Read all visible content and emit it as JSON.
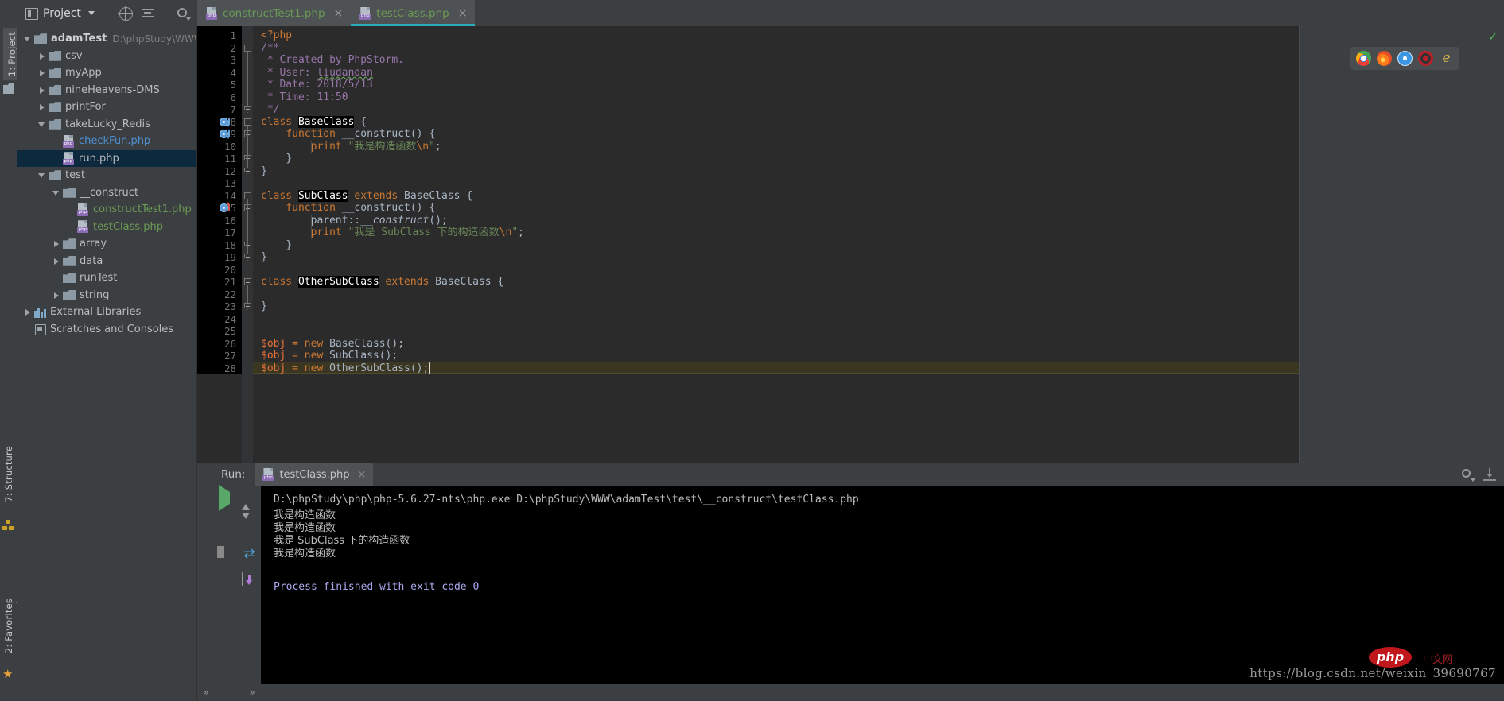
{
  "window": {
    "ide": "PhpStorm"
  },
  "toolbar": {
    "project_button": "Project",
    "icons": [
      "locate-target-icon",
      "collapse-all-icon",
      "settings-gear-icon",
      "hide-panel-icon"
    ]
  },
  "editor_tabs": [
    {
      "label": "constructTest1.php",
      "close": "×",
      "active": false,
      "icon": "php-file-icon"
    },
    {
      "label": "testClass.php",
      "close": "×",
      "active": true,
      "icon": "php-file-icon"
    }
  ],
  "left_tool_window_tabs": [
    {
      "label": "1: Project",
      "selected": true
    },
    {
      "label": "7: Structure",
      "selected": false
    },
    {
      "label": "2: Favorites",
      "selected": false
    }
  ],
  "project_tree": [
    {
      "depth": 0,
      "arrow": "down",
      "icon": "folder",
      "label": "adamTest",
      "bold": true,
      "path": "D:\\phpStudy\\WWW",
      "selected": false
    },
    {
      "depth": 1,
      "arrow": "right",
      "icon": "folder",
      "label": "csv",
      "selected": false
    },
    {
      "depth": 1,
      "arrow": "right",
      "icon": "folder",
      "label": "myApp",
      "selected": false
    },
    {
      "depth": 1,
      "arrow": "right",
      "icon": "folder",
      "label": "nineHeavens-DMS",
      "selected": false
    },
    {
      "depth": 1,
      "arrow": "right",
      "icon": "folder",
      "label": "printFor",
      "selected": false
    },
    {
      "depth": 1,
      "arrow": "down",
      "icon": "folder",
      "label": "takeLucky_Redis",
      "selected": false
    },
    {
      "depth": 2,
      "arrow": "none",
      "icon": "php",
      "label": "checkFun.php",
      "kind": "php-blue",
      "selected": false
    },
    {
      "depth": 2,
      "arrow": "none",
      "icon": "php",
      "label": "run.php",
      "kind": "plain",
      "selected": true
    },
    {
      "depth": 1,
      "arrow": "down",
      "icon": "folder",
      "label": "test",
      "selected": false
    },
    {
      "depth": 2,
      "arrow": "down",
      "icon": "folder",
      "label": "__construct",
      "selected": false
    },
    {
      "depth": 3,
      "arrow": "none",
      "icon": "php",
      "label": "constructTest1.php",
      "kind": "php",
      "selected": false
    },
    {
      "depth": 3,
      "arrow": "none",
      "icon": "php",
      "label": "testClass.php",
      "kind": "php",
      "selected": false
    },
    {
      "depth": 2,
      "arrow": "right",
      "icon": "folder",
      "label": "array",
      "selected": false
    },
    {
      "depth": 2,
      "arrow": "right",
      "icon": "folder",
      "label": "data",
      "selected": false
    },
    {
      "depth": 2,
      "arrow": "none",
      "icon": "folder",
      "label": "runTest",
      "selected": false
    },
    {
      "depth": 2,
      "arrow": "right",
      "icon": "folder",
      "label": "string",
      "selected": false
    },
    {
      "depth": 0,
      "arrow": "right",
      "icon": "library",
      "label": "External Libraries",
      "selected": false
    },
    {
      "depth": 0,
      "arrow": "none",
      "icon": "scratch",
      "label": "Scratches and Consoles",
      "selected": false
    }
  ],
  "code": {
    "file": "testClass.php",
    "first_line": 1,
    "last_line": 28,
    "caret_line": 28,
    "highlighted_line": 28,
    "lines": [
      {
        "n": 1,
        "text": "<?php"
      },
      {
        "n": 2,
        "text": "/**"
      },
      {
        "n": 3,
        "text": " * Created by PhpStorm."
      },
      {
        "n": 4,
        "text": " * User: liudandan"
      },
      {
        "n": 5,
        "text": " * Date: 2018/5/13"
      },
      {
        "n": 6,
        "text": " * Time: 11:50"
      },
      {
        "n": 7,
        "text": " */"
      },
      {
        "n": 8,
        "text": "class BaseClass {"
      },
      {
        "n": 9,
        "text": "    function __construct() {"
      },
      {
        "n": 10,
        "text": "        print \"我是构造函数\\n\";"
      },
      {
        "n": 11,
        "text": "    }"
      },
      {
        "n": 12,
        "text": "}"
      },
      {
        "n": 13,
        "text": ""
      },
      {
        "n": 14,
        "text": "class SubClass extends BaseClass {"
      },
      {
        "n": 15,
        "text": "    function __construct() {"
      },
      {
        "n": 16,
        "text": "        parent::__construct();"
      },
      {
        "n": 17,
        "text": "        print \"我是 SubClass 下的构造函数\\n\";"
      },
      {
        "n": 18,
        "text": "    }"
      },
      {
        "n": 19,
        "text": "}"
      },
      {
        "n": 20,
        "text": ""
      },
      {
        "n": 21,
        "text": "class OtherSubClass extends BaseClass {"
      },
      {
        "n": 22,
        "text": ""
      },
      {
        "n": 23,
        "text": "}"
      },
      {
        "n": 24,
        "text": ""
      },
      {
        "n": 25,
        "text": ""
      },
      {
        "n": 26,
        "text": "$obj = new BaseClass();"
      },
      {
        "n": 27,
        "text": "$obj = new SubClass();"
      },
      {
        "n": 28,
        "text": "$obj = new OtherSubClass();"
      }
    ]
  },
  "browser_bar": {
    "icons": [
      "chrome-icon",
      "firefox-icon",
      "safari-icon",
      "opera-icon",
      "edge-icon"
    ]
  },
  "inspection": {
    "status": "ok-checkmark"
  },
  "run_panel": {
    "label": "Run:",
    "tab": {
      "label": "testClass.php",
      "close": "×",
      "icon": "php-run-icon"
    },
    "header_icons": [
      "settings-gear-icon",
      "export-icon"
    ],
    "tool_icons": [
      "rerun-play-icon",
      "stop-icon",
      "pause-icon",
      "scroll-up-icon",
      "scroll-down-icon",
      "soft-wrap-icon",
      "print-icon"
    ],
    "console": [
      {
        "text": "D:\\phpStudy\\php\\php-5.6.27-nts\\php.exe D:\\phpStudy\\WWW\\adamTest\\test\\__construct\\testClass.php",
        "kind": "mono"
      },
      {
        "text": "我是构造函数",
        "kind": "cn"
      },
      {
        "text": "我是构造函数",
        "kind": "cn"
      },
      {
        "text": "我是 SubClass 下的构造函数",
        "kind": "cn"
      },
      {
        "text": "我是构造函数",
        "kind": "cn"
      },
      {
        "text": "",
        "kind": "mono"
      },
      {
        "text": "Process finished with exit code 0",
        "kind": "finished"
      }
    ]
  },
  "watermark": {
    "url": "https://blog.csdn.net/weixin_39690767",
    "php_logo": "php",
    "cn_logo": "中文网"
  },
  "status_bar": {
    "chevrons": [
      "»",
      "»"
    ]
  },
  "colors": {
    "bg": "#3c3f41",
    "editor_bg": "#2b2b2b",
    "gutter_bg": "#000000",
    "keyword": "#cc7832",
    "string": "#6a8759",
    "phpdoc": "#9876aa",
    "identifier": "#a9b7c6",
    "variable": "#e8723a",
    "selection_tab": "#2aacb8",
    "tree_selection": "#0d293e",
    "caret_row": "#3a3621",
    "php_file": "#6a9a55",
    "console_finished": "#a9a9ef"
  }
}
